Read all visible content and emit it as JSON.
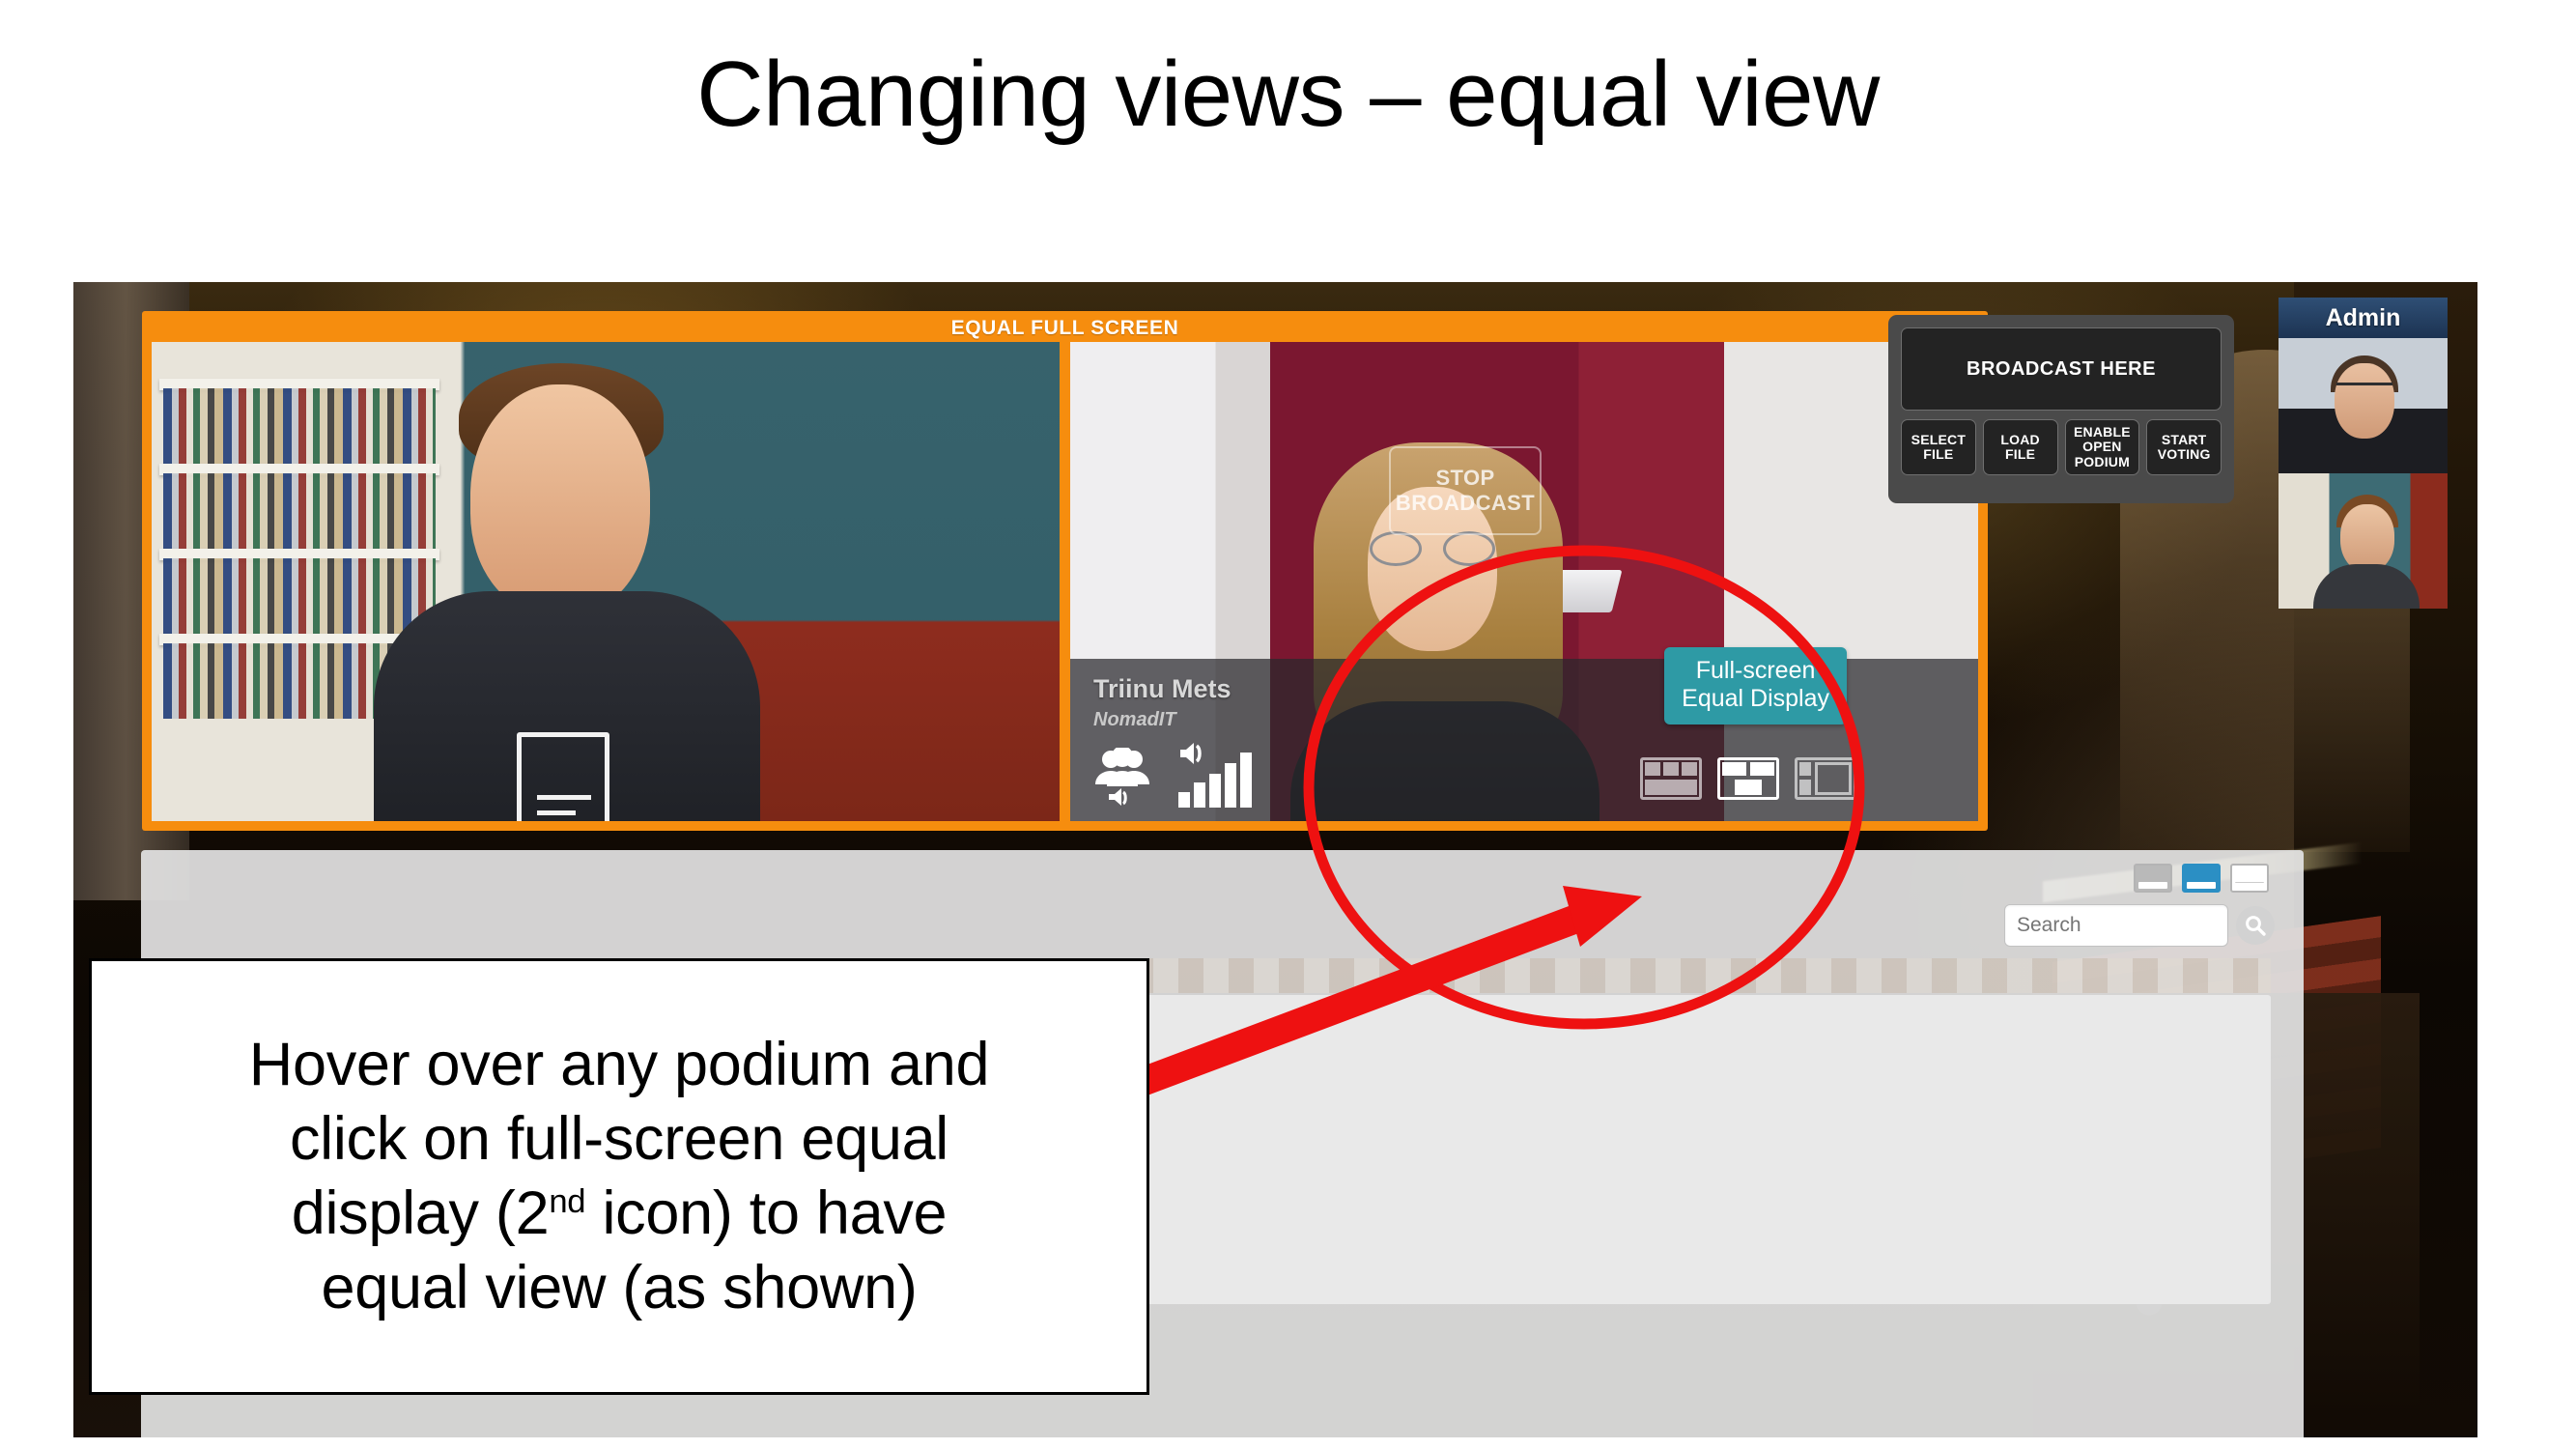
{
  "slide": {
    "title": "Changing views – equal view"
  },
  "callout": {
    "line1": "Hover over any podium and",
    "line2": "click on full-screen equal",
    "line3_a": "display (2",
    "line3_sup": "nd",
    "line3_b": " icon) to have",
    "line4": "equal view (as shown)"
  },
  "app": {
    "equal_window": {
      "title": "EQUAL FULL SCREEN",
      "left_pane": {
        "name": "left-participant-video"
      },
      "right_pane": {
        "stop_broadcast_label": "STOP\nBROADCAST",
        "speaker_name": "Triinu Mets",
        "speaker_org": "NomadIT",
        "people_audio_icon": "people-audio-icon",
        "signal_icon": "signal-bars-icon",
        "tooltip": "Full-screen\nEqual Display",
        "layout_icons": [
          {
            "name": "thumbnails-top-layout-icon",
            "selected": false
          },
          {
            "name": "full-screen-equal-display-icon",
            "selected": true
          },
          {
            "name": "sidebar-left-layout-icon",
            "selected": false
          }
        ]
      }
    },
    "control_panel": {
      "broadcast_label": "BROADCAST HERE",
      "buttons": [
        {
          "label": "SELECT\nFILE",
          "name": "select-file-button"
        },
        {
          "label": "LOAD\nFILE",
          "name": "load-file-button"
        },
        {
          "label": "ENABLE\nOPEN\nPODIUM",
          "name": "enable-open-podium-button"
        },
        {
          "label": "START\nVOTING",
          "name": "start-voting-button"
        }
      ]
    },
    "admin": {
      "header": "Admin",
      "thumbnails": [
        {
          "name": "admin-thumbnail-1"
        },
        {
          "name": "admin-thumbnail-2"
        }
      ]
    },
    "bottom_panel": {
      "search": {
        "placeholder": "Search",
        "value": "",
        "button_icon": "search-icon"
      },
      "layout_icons": [
        {
          "name": "layout-option-1-icon",
          "selected": false
        },
        {
          "name": "layout-option-2-icon",
          "selected": true
        },
        {
          "name": "layout-option-3-icon",
          "selected": false
        }
      ]
    }
  },
  "colors": {
    "accent_orange": "#f68d0e",
    "tooltip_teal": "#2e9aa5",
    "annotation_red": "#ee1111",
    "admin_blue": "#1c3352",
    "selected_blue": "#2b8fc4"
  }
}
